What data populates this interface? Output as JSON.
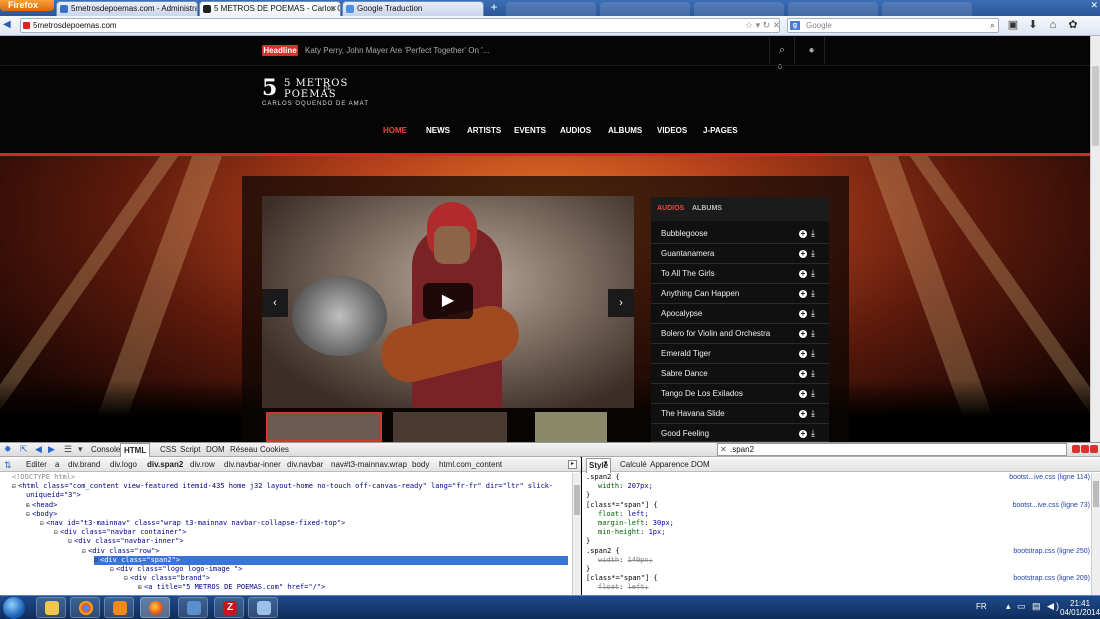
{
  "browser": {
    "firefox_label": "Firefox",
    "tabs": [
      {
        "title": "5metrosdepoemas.com - Administrat..."
      },
      {
        "title": "5 METROS DE POEMAS - Carlos Oque..."
      },
      {
        "title": "Google Traduction"
      }
    ],
    "new_tab": "+",
    "url": "5metrosdepoemas.com",
    "search_engine": "Google"
  },
  "site": {
    "headline_badge": "Headline",
    "headline_text": "Katy Perry, John Mayer Are 'Perfect Together' On '...",
    "cart_count": "0",
    "logo": {
      "line1": "5 METROS",
      "line2": "DE",
      "line3": "POEMAS",
      "subtitle": "CARLOS OQUENDO DE AMAT"
    },
    "nav": [
      "HOME",
      "NEWS",
      "ARTISTS",
      "EVENTS",
      "AUDIOS",
      "ALBUMS",
      "VIDEOS",
      "J-PAGES"
    ],
    "player_tabs": [
      "AUDIOS",
      "ALBUMS"
    ],
    "tracks": [
      "Bubblegoose",
      "Guantanamera",
      "To All The Girls",
      "Anything Can Happen",
      "Apocalypse",
      "Bolero for Violin and Orchestra",
      "Emerald Tiger",
      "Sabre Dance",
      "Tango De Los Exilados",
      "The Havana Slide",
      "Good Feeling"
    ]
  },
  "firebug": {
    "tabs": [
      "Console",
      "HTML",
      "CSS",
      "Script",
      "DOM",
      "Réseau",
      "Cookies"
    ],
    "search_value": ".span2",
    "edit_label": "Editer",
    "breadcrumb": [
      "a",
      "div.brand",
      "div.logo",
      "div.span2",
      "div.row",
      "div.navbar-inner",
      "div.navbar",
      "nav#t3-mainnav.wrap",
      "body",
      "html.com_content"
    ],
    "side_tabs": [
      "Style",
      "Calculé",
      "Apparence",
      "DOM"
    ],
    "html_lines": [
      {
        "indent": 0,
        "text": "<!DOCTYPE html>",
        "kind": "comment"
      },
      {
        "indent": 0,
        "text": "<html class=\"com_content view-featured itemid-435 home j32 layout-home no-touch off-canvas-ready\" lang=\"fr-fr\" dir=\"ltr\" slick-",
        "kind": "tag",
        "twisty": "−"
      },
      {
        "indent": 1,
        "text": "uniqueid=\"3\">",
        "kind": "tag"
      },
      {
        "indent": 1,
        "text": "<head>",
        "kind": "tag",
        "twisty": "+"
      },
      {
        "indent": 1,
        "text": "<body>",
        "kind": "tag",
        "twisty": "−"
      },
      {
        "indent": 2,
        "text": "<nav id=\"t3-mainnav\" class=\"wrap t3-mainnav navbar-collapse-fixed-top\">",
        "kind": "tag",
        "twisty": "−"
      },
      {
        "indent": 3,
        "text": "<div class=\"navbar container\">",
        "kind": "tag",
        "twisty": "−"
      },
      {
        "indent": 4,
        "text": "<div class=\"navbar-inner\">",
        "kind": "tag",
        "twisty": "−"
      },
      {
        "indent": 5,
        "text": "<div class=\"row\">",
        "kind": "tag",
        "twisty": "−"
      },
      {
        "indent": 6,
        "text": "<div class=\"span2\">",
        "kind": "tag",
        "twisty": "−",
        "selected": true
      },
      {
        "indent": 7,
        "text": "<div class=\"logo logo-image \">",
        "kind": "tag",
        "twisty": "−"
      },
      {
        "indent": 8,
        "text": "<div class=\"brand\">",
        "kind": "tag",
        "twisty": "−"
      },
      {
        "indent": 9,
        "text": "<a title=\"5 METROS DE POEMAS.com\" href=\"/\">",
        "kind": "tag",
        "twisty": "+"
      }
    ],
    "css_rules": [
      {
        "text": ".span2 {",
        "kind": "sel",
        "source": "bootst...ive.css (ligne 114)"
      },
      {
        "prop": "width",
        "val": "207px;"
      },
      {
        "text": "}",
        "kind": "sel"
      },
      {
        "text": "[class*=\"span\"] {",
        "kind": "sel",
        "source": "bootst...ive.css (ligne 73)"
      },
      {
        "prop": "float",
        "val": "left;"
      },
      {
        "prop": "margin-left",
        "val": "30px;"
      },
      {
        "prop": "min-height",
        "val": "1px;"
      },
      {
        "text": "}",
        "kind": "sel"
      },
      {
        "text": ".span2 {",
        "kind": "sel",
        "source": "bootstrap.css (ligne 250)"
      },
      {
        "prop": "width",
        "val": "140px;",
        "strike": true
      },
      {
        "text": "}",
        "kind": "sel"
      },
      {
        "text": "[class*=\"span\"] {",
        "kind": "sel",
        "source": "bootstrap.css (ligne 209)"
      },
      {
        "prop": "float",
        "val": "left;",
        "strike": true
      }
    ]
  },
  "taskbar": {
    "lang": "FR",
    "time": "21:41",
    "date": "04/01/2014"
  }
}
